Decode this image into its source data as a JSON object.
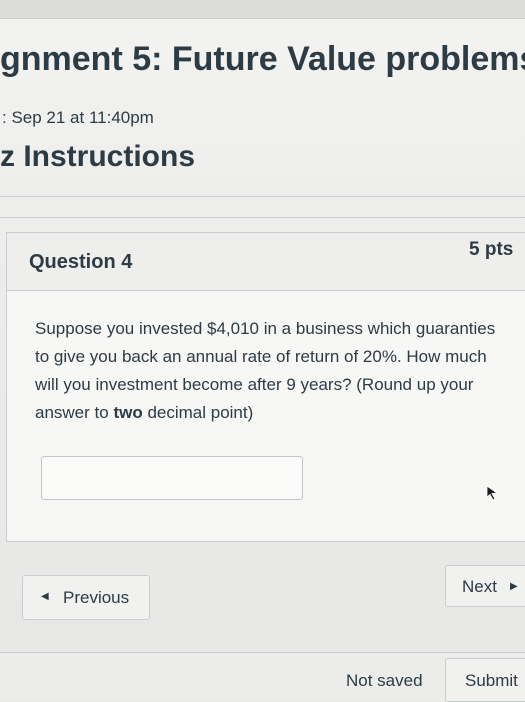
{
  "header": {
    "title": "gnment 5: Future Value problems",
    "due": ": Sep 21 at 11:40pm",
    "instructions_heading": "z Instructions"
  },
  "question": {
    "name": "Question 4",
    "points": "5 pts",
    "text_before": "Suppose you invested $4,010 in a business which guaranties to give you back an annual rate of return of 20%. How much will you investment become after 9 years? (Round up your answer to ",
    "text_bold": "two",
    "text_after": " decimal point)",
    "answer_value": ""
  },
  "navigation": {
    "previous_label": "Previous",
    "next_label": "Next",
    "previous_icon": "triangle-left-icon",
    "next_icon": "triangle-right-icon"
  },
  "footer": {
    "save_status": "Not saved",
    "submit_label": "Submit"
  },
  "colors": {
    "text": "#2d3b45",
    "border": "#c7cdd1",
    "background": "#ecedeb"
  }
}
